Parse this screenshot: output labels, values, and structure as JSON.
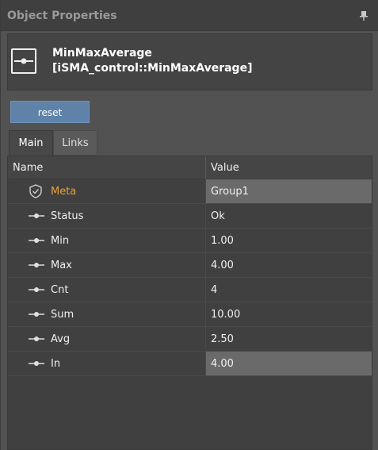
{
  "panel": {
    "title": "Object Properties"
  },
  "object": {
    "name": "MinMaxAverage",
    "type": "[iSMA_control::MinMaxAverage]"
  },
  "actions": {
    "reset_label": "reset"
  },
  "tabs": [
    {
      "label": "Main",
      "active": true
    },
    {
      "label": "Links",
      "active": false
    }
  ],
  "grid": {
    "columns": {
      "name": "Name",
      "value": "Value"
    },
    "rows": [
      {
        "icon": "shield-icon",
        "name": "Meta",
        "value": "Group1"
      },
      {
        "icon": "slot-icon",
        "name": "Status",
        "value": "Ok"
      },
      {
        "icon": "slot-icon",
        "name": "Min",
        "value": "1.00"
      },
      {
        "icon": "slot-icon",
        "name": "Max",
        "value": "4.00"
      },
      {
        "icon": "slot-icon",
        "name": "Cnt",
        "value": "4"
      },
      {
        "icon": "slot-icon",
        "name": "Sum",
        "value": "10.00"
      },
      {
        "icon": "slot-icon",
        "name": "Avg",
        "value": "2.50"
      },
      {
        "icon": "slot-icon",
        "name": "In",
        "value": "4.00"
      }
    ]
  },
  "colors": {
    "meta_label": "#e6a23c",
    "reset_button": "#5f82a8",
    "panel_bg": "#525252"
  }
}
